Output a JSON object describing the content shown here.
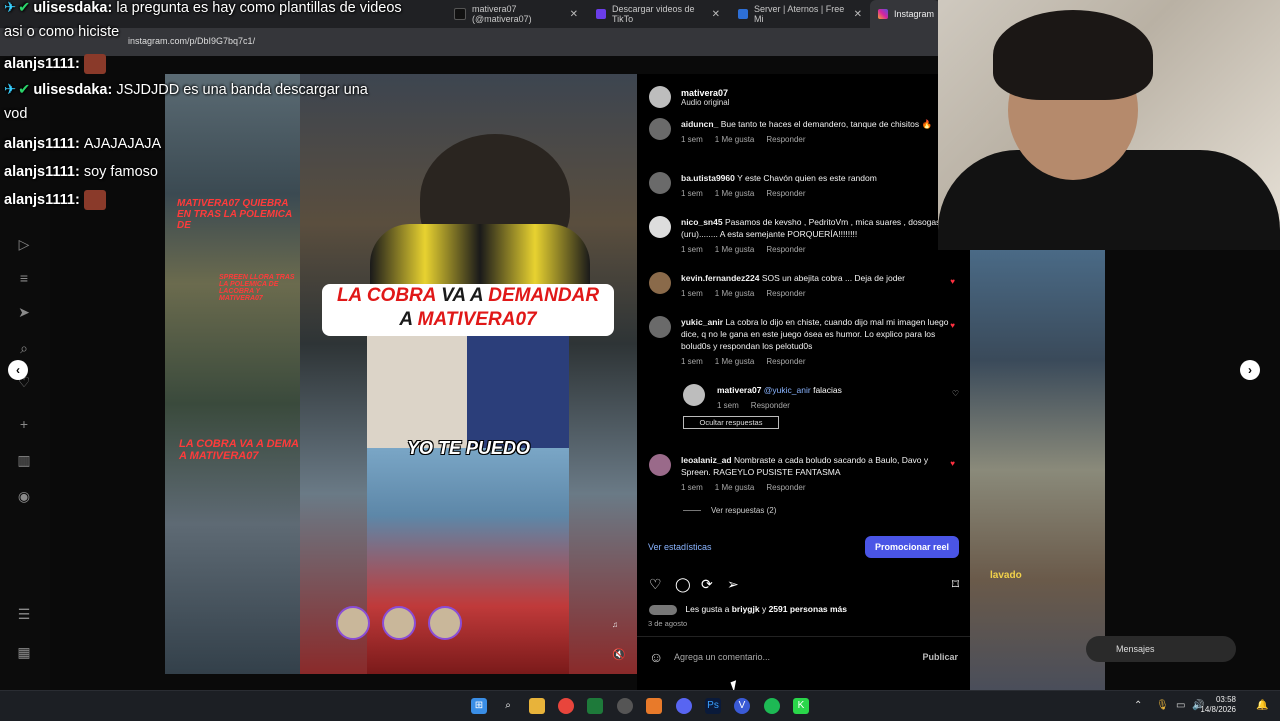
{
  "browser": {
    "tabs": [
      {
        "label": "Instagram",
        "icon": "instagram-icon",
        "active": true
      },
      {
        "label": "mativera07 (@mativera07)",
        "icon": "tiktok-icon"
      },
      {
        "label": "Descargar videos de TikTo",
        "icon": "download-icon"
      },
      {
        "label": "Server | Aternos | Free Mi",
        "icon": "aternos-icon"
      }
    ],
    "url": "instagram.com/p/DbI9G7bq7c1/"
  },
  "chat": [
    {
      "user": "ulisesdaka",
      "text": "la pregunta es hay como plantillas de videos asi o como hiciste",
      "user_color": "#ffffff",
      "badges": true
    },
    {
      "user": "alanjs1111",
      "text": "",
      "emote": true
    },
    {
      "user": "ulisesdaka",
      "text": "JSJDJDD es una banda descargar una vod",
      "badges": true
    },
    {
      "user": "alanjs1111",
      "text": "AJAJAJAJA"
    },
    {
      "user": "alanjs1111",
      "text": "soy famoso"
    },
    {
      "user": "alanjs1111",
      "text": "",
      "emote": true
    }
  ],
  "video": {
    "headline_1": "LA COBRA",
    "headline_2": "VA A",
    "headline_3": "DEMANDAR",
    "headline_4": "A",
    "headline_5": "MATIVERA07",
    "caption": "YO TE PUEDO"
  },
  "collage": {
    "label_top": "MATIVERA07 QUIEBRA EN TRAS LA POLEMICA DE",
    "label_mid": "SPREEN LLORA TRAS LA POLEMICA DE LACOBRA Y MATIVERA07",
    "label_bottom": "LA COBRA VA A DEMA A MATIVERA07"
  },
  "panel": {
    "author": "mativera07",
    "subtitle": "Audio original",
    "comments": [
      {
        "user": "aiduncn_",
        "text": "Bue tanto te haces el demandero, tanque de chisitos 🔥",
        "time": "1 sem",
        "likes": "1 Me gusta",
        "reply": "Responder",
        "liked": false
      },
      {
        "user": "ba.utista9960",
        "text": "Y este Chavón quien es este random",
        "time": "1 sem",
        "likes": "1 Me gusta",
        "reply": "Responder",
        "liked": false
      },
      {
        "user": "nico_sn45",
        "text": "Pasamos de kevsho , PedritoVm , mica suares , dosogas (uru)........ A esta semejante PORQUERÍA!!!!!!!!",
        "time": "1 sem",
        "likes": "1 Me gusta",
        "reply": "Responder",
        "liked": false
      },
      {
        "user": "kevin.fernandez224",
        "text": "SOS un abejita cobra ... Deja de joder",
        "time": "1 sem",
        "likes": "1 Me gusta",
        "reply": "Responder",
        "liked": true
      },
      {
        "user": "yukic_anir",
        "text": "La cobra lo dijo en chiste, cuando dijo mal mi imagen luego dice, q no le gana en este juego ósea es humor. Lo explico para los bolud0s y respondan los pelotud0s",
        "time": "1 sem",
        "likes": "1 Me gusta",
        "reply": "Responder",
        "liked": true
      },
      {
        "user": "leoalaniz_ad",
        "text": "Nombraste a cada boludo sacando a Baulo, Davo y Spreen. RAGEYLO PUSISTE FANTASMA",
        "time": "1 sem",
        "likes": "1 Me gusta",
        "reply": "Responder",
        "liked": true
      }
    ],
    "reply": {
      "user": "mativera07",
      "mention": "@yukic_anir",
      "text": "falacias",
      "time": "1 sem",
      "action": "Responder"
    },
    "hide_replies": "Ocultar respuestas",
    "view_replies": "Ver respuestas (2)",
    "stats_link": "Ver estadísticas",
    "promote_button": "Promocionar reel",
    "likes_prefix": "Les gusta a",
    "likes_user": "briygjk",
    "likes_mid": "y",
    "likes_count": "2591 personas más",
    "date": "3 de agosto",
    "comment_placeholder": "Agrega un comentario...",
    "publish": "Publicar"
  },
  "right": {
    "label": "lavado",
    "messages": "Mensajes"
  },
  "taskbar": {
    "time": "03:58",
    "date": "14/8/2026"
  },
  "colors": {
    "accent_blue": "#4a55e6",
    "link_blue": "#8ab4ff",
    "heart_red": "#ff3040",
    "headline_red": "#e01818"
  }
}
